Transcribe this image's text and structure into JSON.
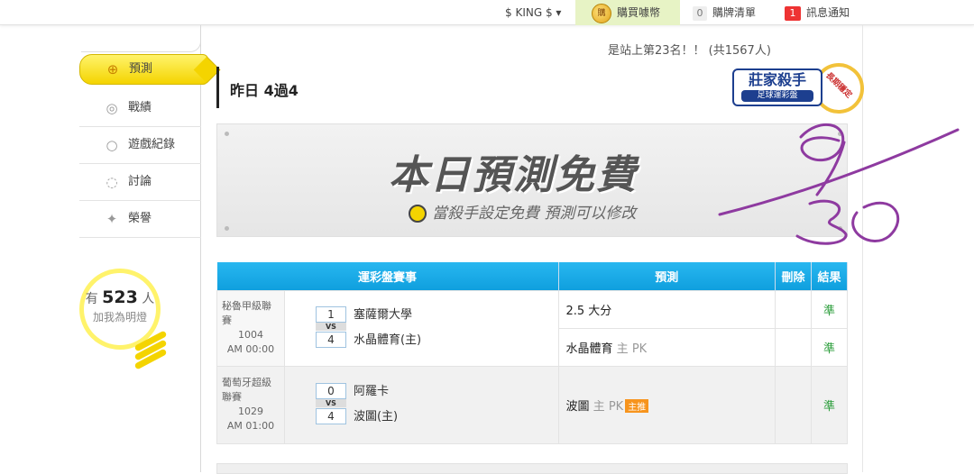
{
  "topbar": {
    "user": "$ KING $",
    "caret": "▾",
    "coin_icon": "購",
    "buy_coins": "購買噱幣",
    "list_count": "0",
    "list_label": "購牌清單",
    "msg_count": "1",
    "msg_label": "訊息通知"
  },
  "sidebar": {
    "items": [
      {
        "label": "預測",
        "icon": "⊕"
      },
      {
        "label": "戰績",
        "icon": "◎"
      },
      {
        "label": "遊戲紀錄",
        "icon": "○"
      },
      {
        "label": "討論",
        "icon": "◌"
      },
      {
        "label": "榮譽",
        "icon": "✦"
      }
    ]
  },
  "fans": {
    "prefix": "有",
    "count": "523",
    "suffix": "人",
    "sub": "加我為明燈"
  },
  "rank": "是站上第23名！！ (共1567人)",
  "title": "昨日 4過4",
  "seal": {
    "main": "莊家殺手",
    "sub": "足球運彩盤",
    "ring": "長期穩定"
  },
  "banner": {
    "big": "本日預測免費",
    "small": "當殺手設定免費 預測可以修改"
  },
  "table": {
    "headers": {
      "event": "運彩盤賽事",
      "pred": "預測",
      "del": "刪除",
      "result": "結果"
    },
    "vs": "VS",
    "matches": [
      {
        "league": "秘魯甲級聯賽",
        "date": "1004",
        "time": "AM 00:00",
        "team1_score": "1",
        "team1": "塞薩爾大學",
        "team2_score": "4",
        "team2": "水晶體育(主)",
        "pred1": "2.5 大分",
        "res1": "準",
        "pred2_team": "水晶體育",
        "pred2_home": "主",
        "pred2_line": "PK",
        "res2": "準"
      },
      {
        "league": "葡萄牙超級聯賽",
        "date": "1029",
        "time": "AM 01:00",
        "team1_score": "0",
        "team1": "阿羅卡",
        "team2_score": "4",
        "team2": "波圖(主)",
        "pred_team": "波圖",
        "pred_home": "主",
        "pred_line": "PK",
        "pred_tag": "主推",
        "res": "準"
      }
    ]
  },
  "colors": {
    "accent_yellow": "#f4d400",
    "header_blue": "#12a4e4",
    "win_green": "#2a9d3a",
    "scribble": "#8e3aa0"
  }
}
